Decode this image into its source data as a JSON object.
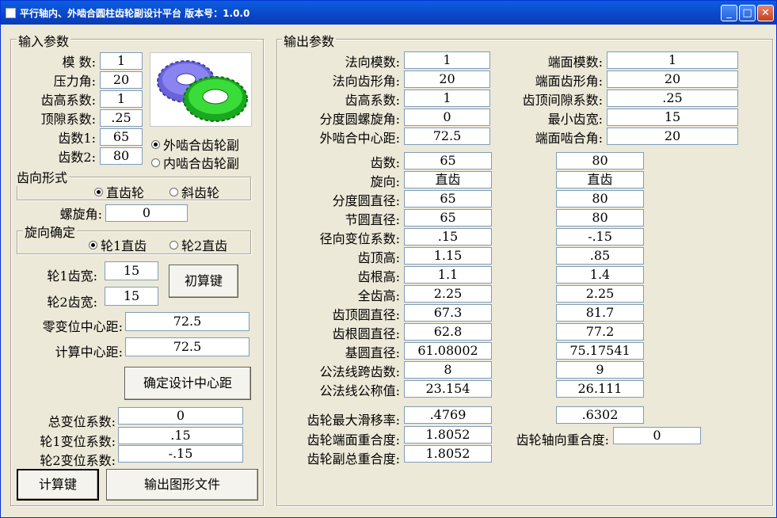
{
  "window": {
    "title": "平行轴内、外啮合圆柱齿轮副设计平台 版本号：1.0.0"
  },
  "input": {
    "legend": "输入参数",
    "module_label": "模    数:",
    "module": "1",
    "pressure_angle_label": "压力角:",
    "pressure_angle": "20",
    "addendum_coef_label": "齿高系数:",
    "addendum_coef": "1",
    "clearance_coef_label": "顶隙系数:",
    "clearance_coef": ".25",
    "teeth1_label": "齿数1:",
    "teeth1": "65",
    "teeth2_label": "齿数2:",
    "teeth2": "80",
    "mesh_external": "外啮合齿轮副",
    "mesh_internal": "内啮合齿轮副",
    "tooth_form_legend": "齿向形式",
    "spur": "直齿轮",
    "helical": "斜齿轮",
    "helix_angle_label": "螺旋角:",
    "helix_angle": "0",
    "hand_legend": "旋向确定",
    "hand1": "轮1直齿",
    "hand2": "轮2直齿",
    "width1_label": "轮1齿宽:",
    "width1": "15",
    "width2_label": "轮2齿宽:",
    "width2": "15",
    "initial_calc_button": "初算键",
    "zero_shift_center_label": "零变位中心距:",
    "zero_shift_center": "72.5",
    "calc_center_label": "计算中心距:",
    "calc_center": "72.5",
    "confirm_center_button": "确定设计中心距",
    "total_shift_label": "总变位系数:",
    "total_shift": "0",
    "shift1_label": "轮1变位系数:",
    "shift1": ".15",
    "shift2_label": "轮2变位系数:",
    "shift2": "-.15",
    "calc_button": "计算键",
    "export_button": "输出图形文件"
  },
  "output": {
    "legend": "输出参数",
    "normal_module_label": "法向模数:",
    "normal_module": "1",
    "normal_pa_label": "法向齿形角:",
    "normal_pa": "20",
    "addendum_coef_label": "齿高系数:",
    "addendum_coef": "1",
    "helix_label": "分度圆螺旋角:",
    "helix": "0",
    "ext_center_label": "外啮合中心距:",
    "ext_center": "72.5",
    "transverse_module_label": "端面模数:",
    "transverse_module": "1",
    "transverse_pa_label": "端面齿形角:",
    "transverse_pa": "20",
    "tip_clearance_label": "齿顶间隙系数:",
    "tip_clearance": ".25",
    "min_width_label": "最小齿宽:",
    "min_width": "15",
    "transverse_mesh_angle_label": "端面啮合角:",
    "transverse_mesh_angle": "20",
    "rows": [
      {
        "label": "齿数:",
        "g1": "65",
        "g2": "80"
      },
      {
        "label": "旋向:",
        "g1": "直齿",
        "g2": "直齿"
      },
      {
        "label": "分度圆直径:",
        "g1": "65",
        "g2": "80"
      },
      {
        "label": "节圆直径:",
        "g1": "65",
        "g2": "80"
      },
      {
        "label": "径向变位系数:",
        "g1": ".15",
        "g2": "-.15"
      },
      {
        "label": "齿顶高:",
        "g1": "1.15",
        "g2": ".85"
      },
      {
        "label": "齿根高:",
        "g1": "1.1",
        "g2": "1.4"
      },
      {
        "label": "全齿高:",
        "g1": "2.25",
        "g2": "2.25"
      },
      {
        "label": "齿顶圆直径:",
        "g1": "67.3",
        "g2": "81.7"
      },
      {
        "label": "齿根圆直径:",
        "g1": "62.8",
        "g2": "77.2"
      },
      {
        "label": "基圆直径:",
        "g1": "61.08002",
        "g2": "75.17541"
      },
      {
        "label": "公法线跨齿数:",
        "g1": "8",
        "g2": "9"
      },
      {
        "label": "公法线公称值:",
        "g1": "23.154",
        "g2": "26.111"
      }
    ],
    "max_slide_label": "齿轮最大滑移率:",
    "max_slide1": ".4769",
    "max_slide2": ".6302",
    "transverse_contact_label": "齿轮端面重合度:",
    "transverse_contact": "1.8052",
    "axial_contact_label": "齿轮轴向重合度:",
    "axial_contact": "0",
    "total_contact_label": "齿轮副总重合度:",
    "total_contact": "1.8052"
  }
}
